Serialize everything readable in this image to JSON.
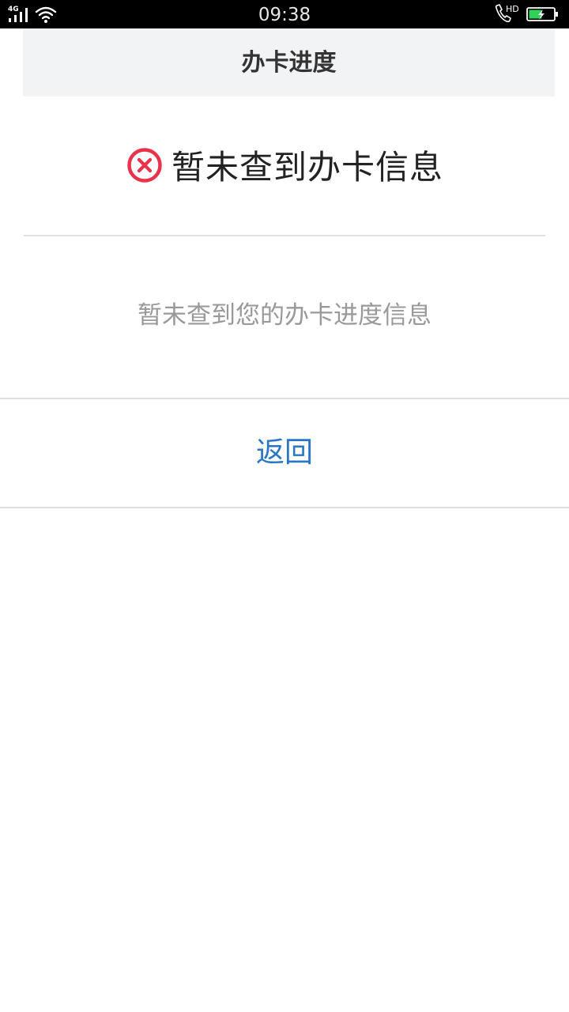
{
  "status_bar": {
    "network": "4G",
    "time": "09:38",
    "call_badge": "HD",
    "icons": [
      "signal-icon",
      "wifi-icon",
      "phone-hd-icon",
      "battery-charging-icon"
    ],
    "battery_color": "#2fd158"
  },
  "nav": {
    "title": "办卡进度"
  },
  "result": {
    "title": "暂未查到办卡信息",
    "icon": "error-circle-icon",
    "icon_color": "#e8334a"
  },
  "message": "暂未查到您的办卡进度信息",
  "actions": {
    "back_label": "返回",
    "link_color": "#2a76c6"
  }
}
